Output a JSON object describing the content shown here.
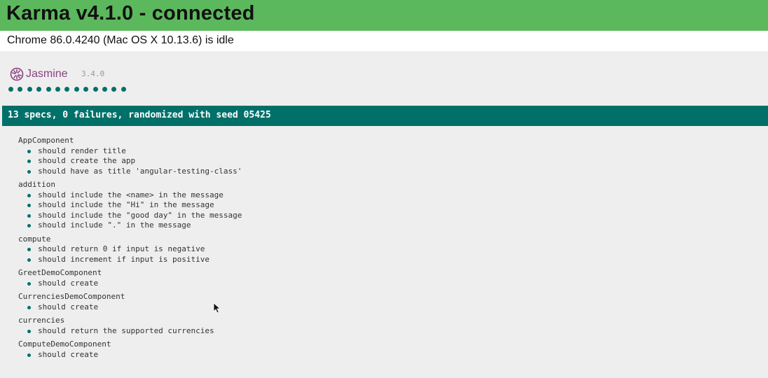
{
  "banner": {
    "title": "Karma v4.1.0 - connected",
    "color": "#5cb85c"
  },
  "browser": {
    "status": "Chrome 86.0.4240 (Mac OS X 10.13.6) is idle"
  },
  "jasmine": {
    "logo_text": "Jasmine",
    "logo_icon": "jasmine-flower-icon",
    "version": "3.4.0",
    "dot_count": 13,
    "accent_color": "#007069"
  },
  "summary": {
    "text": "13 specs, 0 failures, randomized with seed 05425"
  },
  "suites": [
    {
      "name": "AppComponent",
      "specs": [
        "should render title",
        "should create the app",
        "should have as title 'angular-testing-class'"
      ]
    },
    {
      "name": "addition",
      "specs": [
        "should include the <name> in the message",
        "should include the \"Hi\" in the message",
        "should include the \"good day\" in the message",
        "should include \".\" in the message"
      ]
    },
    {
      "name": "compute",
      "specs": [
        "should return 0 if input is negative",
        "should increment if input is positive"
      ]
    },
    {
      "name": "GreetDemoComponent",
      "specs": [
        "should create"
      ]
    },
    {
      "name": "CurrenciesDemoComponent",
      "specs": [
        "should create"
      ]
    },
    {
      "name": "currencies",
      "specs": [
        "should return the supported currencies"
      ]
    },
    {
      "name": "ComputeDemoComponent",
      "specs": [
        "should create"
      ]
    }
  ]
}
